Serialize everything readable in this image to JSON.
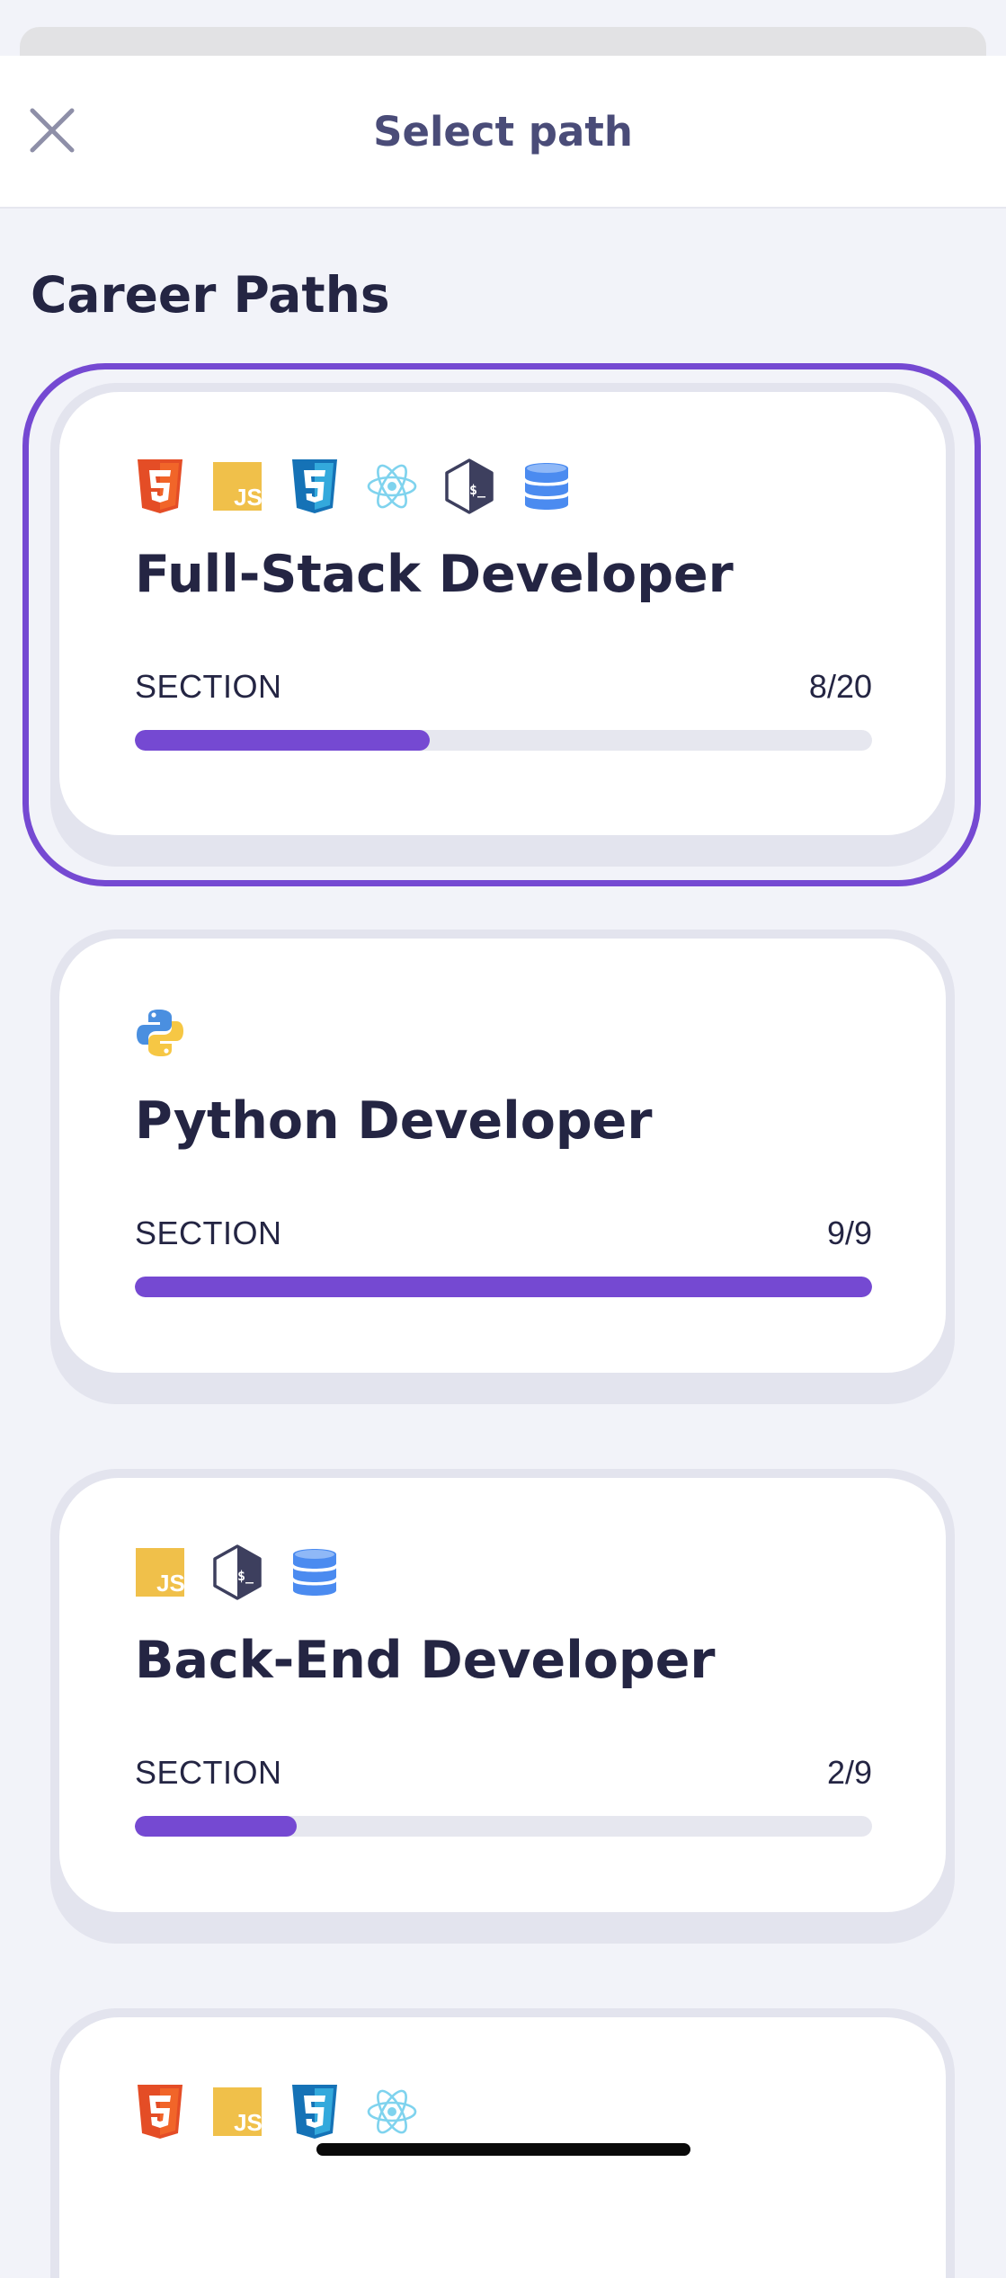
{
  "header": {
    "title": "Select path",
    "close_icon": "close-icon"
  },
  "section": {
    "title": "Career Paths"
  },
  "colors": {
    "accent": "#7549d2",
    "text": "#242543",
    "header_text": "#4a4c78",
    "track": "#e6e7ef"
  },
  "paths": [
    {
      "title": "Full-Stack Developer",
      "icons": [
        "html5-icon",
        "javascript-icon",
        "css3-icon",
        "react-icon",
        "terminal-icon",
        "database-icon"
      ],
      "section_label": "SECTION",
      "section_count": "8/20",
      "progress": 0.4,
      "selected": true
    },
    {
      "title": "Python Developer",
      "icons": [
        "python-icon"
      ],
      "section_label": "SECTION",
      "section_count": "9/9",
      "progress": 1.0,
      "selected": false
    },
    {
      "title": "Back-End Developer",
      "icons": [
        "javascript-icon",
        "terminal-icon",
        "database-icon"
      ],
      "section_label": "SECTION",
      "section_count": "2/9",
      "progress": 0.22,
      "selected": false
    },
    {
      "title": "",
      "icons": [
        "html5-icon",
        "javascript-icon",
        "css3-icon",
        "react-icon"
      ],
      "section_label": "",
      "section_count": "",
      "progress": null,
      "selected": false
    }
  ]
}
